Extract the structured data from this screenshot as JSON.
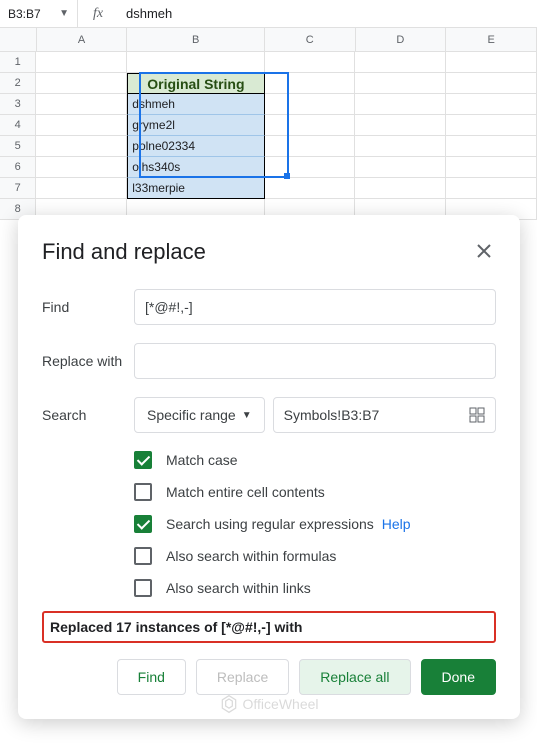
{
  "formula_bar": {
    "name_box": "B3:B7",
    "fx": "fx",
    "formula": "dshmeh"
  },
  "columns": [
    "A",
    "B",
    "C",
    "D",
    "E"
  ],
  "rows": [
    "1",
    "2",
    "3",
    "4",
    "5",
    "6",
    "7",
    "8"
  ],
  "table": {
    "header": "Original String",
    "data": [
      "dshmeh",
      "gryme2l",
      "polne02334",
      "oihs340s",
      "l33merpie"
    ]
  },
  "dialog": {
    "title": "Find and replace",
    "find_label": "Find",
    "find_value": "[*@#!,-]",
    "replace_label": "Replace with",
    "replace_value": "",
    "search_label": "Search",
    "search_scope": "Specific range",
    "search_range": "Symbols!B3:B7",
    "checks": {
      "match_case": "Match case",
      "match_entire": "Match entire cell contents",
      "regex": "Search using regular expressions",
      "formulas": "Also search within formulas",
      "links": "Also search within links"
    },
    "help": "Help",
    "status": "Replaced 17 instances of [*@#!,-] with",
    "buttons": {
      "find": "Find",
      "replace": "Replace",
      "replace_all": "Replace all",
      "done": "Done"
    }
  },
  "watermark": "OfficeWheel"
}
